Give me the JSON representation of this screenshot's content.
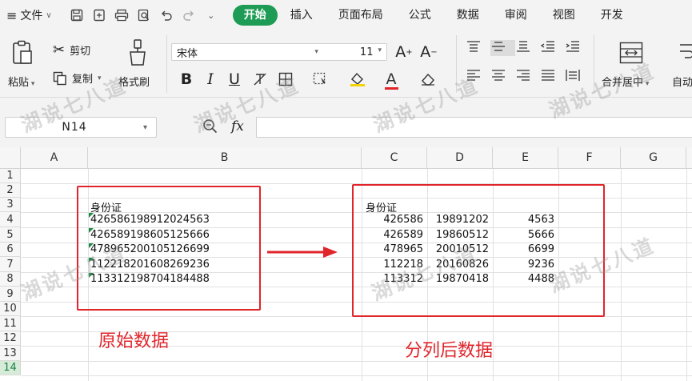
{
  "menubar": {
    "file_label": "文件",
    "tabs": [
      "开始",
      "插入",
      "页面布局",
      "公式",
      "数据",
      "审阅",
      "视图",
      "开发"
    ],
    "active_tab": "开始"
  },
  "ribbon": {
    "paste_label": "粘贴",
    "cut_label": "剪切",
    "copy_label": "复制",
    "format_painter_label": "格式刷",
    "font_name": "宋体",
    "font_size": "11",
    "merge_label": "合并居中",
    "auto_label": "自动",
    "bold": "B",
    "italic": "I",
    "underline": "U",
    "font_color_letter": "A"
  },
  "formula_bar": {
    "name_box": "N14",
    "fx_label": "fx",
    "formula": ""
  },
  "grid": {
    "columns": [
      "A",
      "B",
      "C",
      "D",
      "E",
      "F",
      "G"
    ],
    "rows": [
      "1",
      "2",
      "3",
      "4",
      "5",
      "6",
      "7",
      "8",
      "9",
      "10",
      "11",
      "12",
      "13",
      "14"
    ],
    "selected_row": "14",
    "original_header": "身份证",
    "original_ids": [
      "426586198912024563",
      "426589198605125666",
      "478965200105126699",
      "112218201608269236",
      "113312198704184488"
    ],
    "split_header": "身份证",
    "split_rows": [
      [
        "426586",
        "19891202",
        "4563"
      ],
      [
        "426589",
        "19860512",
        "5666"
      ],
      [
        "478965",
        "20010512",
        "6699"
      ],
      [
        "112218",
        "20160826",
        "9236"
      ],
      [
        "113312",
        "19870418",
        "4488"
      ]
    ]
  },
  "annotations": {
    "left_caption": "原始数据",
    "right_caption": "分列后数据",
    "accent_color": "#e0252b",
    "brand_color": "#1e9c55"
  },
  "watermark": "湖说七八道"
}
